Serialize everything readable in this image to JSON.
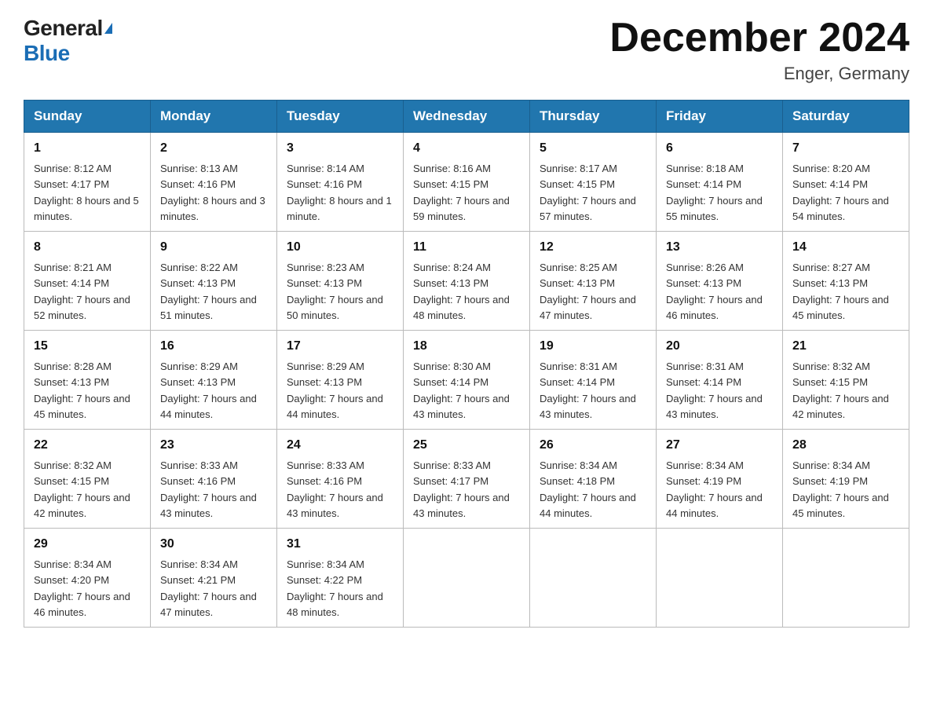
{
  "header": {
    "logo_general": "General",
    "logo_blue": "Blue",
    "month_title": "December 2024",
    "location": "Enger, Germany"
  },
  "weekdays": [
    "Sunday",
    "Monday",
    "Tuesday",
    "Wednesday",
    "Thursday",
    "Friday",
    "Saturday"
  ],
  "weeks": [
    [
      {
        "day": "1",
        "sunrise": "8:12 AM",
        "sunset": "4:17 PM",
        "daylight": "8 hours and 5 minutes."
      },
      {
        "day": "2",
        "sunrise": "8:13 AM",
        "sunset": "4:16 PM",
        "daylight": "8 hours and 3 minutes."
      },
      {
        "day": "3",
        "sunrise": "8:14 AM",
        "sunset": "4:16 PM",
        "daylight": "8 hours and 1 minute."
      },
      {
        "day": "4",
        "sunrise": "8:16 AM",
        "sunset": "4:15 PM",
        "daylight": "7 hours and 59 minutes."
      },
      {
        "day": "5",
        "sunrise": "8:17 AM",
        "sunset": "4:15 PM",
        "daylight": "7 hours and 57 minutes."
      },
      {
        "day": "6",
        "sunrise": "8:18 AM",
        "sunset": "4:14 PM",
        "daylight": "7 hours and 55 minutes."
      },
      {
        "day": "7",
        "sunrise": "8:20 AM",
        "sunset": "4:14 PM",
        "daylight": "7 hours and 54 minutes."
      }
    ],
    [
      {
        "day": "8",
        "sunrise": "8:21 AM",
        "sunset": "4:14 PM",
        "daylight": "7 hours and 52 minutes."
      },
      {
        "day": "9",
        "sunrise": "8:22 AM",
        "sunset": "4:13 PM",
        "daylight": "7 hours and 51 minutes."
      },
      {
        "day": "10",
        "sunrise": "8:23 AM",
        "sunset": "4:13 PM",
        "daylight": "7 hours and 50 minutes."
      },
      {
        "day": "11",
        "sunrise": "8:24 AM",
        "sunset": "4:13 PM",
        "daylight": "7 hours and 48 minutes."
      },
      {
        "day": "12",
        "sunrise": "8:25 AM",
        "sunset": "4:13 PM",
        "daylight": "7 hours and 47 minutes."
      },
      {
        "day": "13",
        "sunrise": "8:26 AM",
        "sunset": "4:13 PM",
        "daylight": "7 hours and 46 minutes."
      },
      {
        "day": "14",
        "sunrise": "8:27 AM",
        "sunset": "4:13 PM",
        "daylight": "7 hours and 45 minutes."
      }
    ],
    [
      {
        "day": "15",
        "sunrise": "8:28 AM",
        "sunset": "4:13 PM",
        "daylight": "7 hours and 45 minutes."
      },
      {
        "day": "16",
        "sunrise": "8:29 AM",
        "sunset": "4:13 PM",
        "daylight": "7 hours and 44 minutes."
      },
      {
        "day": "17",
        "sunrise": "8:29 AM",
        "sunset": "4:13 PM",
        "daylight": "7 hours and 44 minutes."
      },
      {
        "day": "18",
        "sunrise": "8:30 AM",
        "sunset": "4:14 PM",
        "daylight": "7 hours and 43 minutes."
      },
      {
        "day": "19",
        "sunrise": "8:31 AM",
        "sunset": "4:14 PM",
        "daylight": "7 hours and 43 minutes."
      },
      {
        "day": "20",
        "sunrise": "8:31 AM",
        "sunset": "4:14 PM",
        "daylight": "7 hours and 43 minutes."
      },
      {
        "day": "21",
        "sunrise": "8:32 AM",
        "sunset": "4:15 PM",
        "daylight": "7 hours and 42 minutes."
      }
    ],
    [
      {
        "day": "22",
        "sunrise": "8:32 AM",
        "sunset": "4:15 PM",
        "daylight": "7 hours and 42 minutes."
      },
      {
        "day": "23",
        "sunrise": "8:33 AM",
        "sunset": "4:16 PM",
        "daylight": "7 hours and 43 minutes."
      },
      {
        "day": "24",
        "sunrise": "8:33 AM",
        "sunset": "4:16 PM",
        "daylight": "7 hours and 43 minutes."
      },
      {
        "day": "25",
        "sunrise": "8:33 AM",
        "sunset": "4:17 PM",
        "daylight": "7 hours and 43 minutes."
      },
      {
        "day": "26",
        "sunrise": "8:34 AM",
        "sunset": "4:18 PM",
        "daylight": "7 hours and 44 minutes."
      },
      {
        "day": "27",
        "sunrise": "8:34 AM",
        "sunset": "4:19 PM",
        "daylight": "7 hours and 44 minutes."
      },
      {
        "day": "28",
        "sunrise": "8:34 AM",
        "sunset": "4:19 PM",
        "daylight": "7 hours and 45 minutes."
      }
    ],
    [
      {
        "day": "29",
        "sunrise": "8:34 AM",
        "sunset": "4:20 PM",
        "daylight": "7 hours and 46 minutes."
      },
      {
        "day": "30",
        "sunrise": "8:34 AM",
        "sunset": "4:21 PM",
        "daylight": "7 hours and 47 minutes."
      },
      {
        "day": "31",
        "sunrise": "8:34 AM",
        "sunset": "4:22 PM",
        "daylight": "7 hours and 48 minutes."
      },
      null,
      null,
      null,
      null
    ]
  ]
}
